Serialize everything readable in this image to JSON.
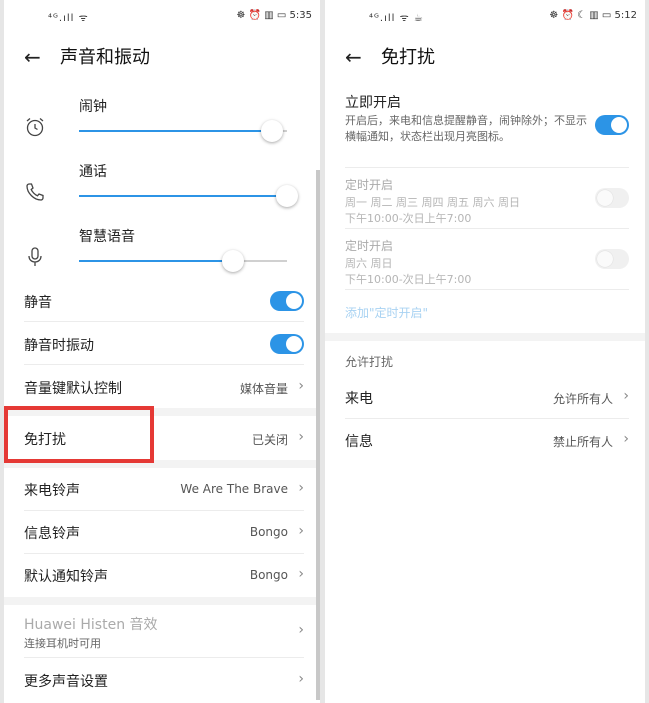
{
  "left": {
    "status": {
      "signal": "⁴ᴳ.ıll ᯤ",
      "right": "☸ ⏰ ▥ ▭ 5:35"
    },
    "title": "声音和振动",
    "volumes": [
      {
        "label": "闹钟",
        "icon": "alarm-clock-icon",
        "level": 0.93
      },
      {
        "label": "通话",
        "icon": "phone-icon",
        "level": 1.0
      },
      {
        "label": "智慧语音",
        "icon": "microphone-icon",
        "level": 0.74
      }
    ],
    "mute_label": "静音",
    "mute_on": true,
    "mute_vibrate_label": "静音时振动",
    "mute_vibrate_on": true,
    "volume_key_label": "音量键默认控制",
    "volume_key_value": "媒体音量",
    "dnd_label": "免打扰",
    "dnd_value": "已关闭",
    "ringtone_label": "来电铃声",
    "ringtone_value": "We Are The Brave",
    "message_tone_label": "信息铃声",
    "message_tone_value": "Bongo",
    "notification_tone_label": "默认通知铃声",
    "notification_tone_value": "Bongo",
    "histen_label": "Huawei Histen 音效",
    "histen_sub": "连接耳机时可用",
    "more_label": "更多声音设置"
  },
  "right": {
    "status": {
      "signal": "⁴ᴳ.ıll ᯤ ☕",
      "right": "☸ ⏰ ☾ ▥ ▭ 5:12"
    },
    "title": "免打扰",
    "immediate_label": "立即开启",
    "immediate_desc": "开启后，来电和信息提醒静音，闹钟除外；不显示横幅通知，状态栏出现月亮图标。",
    "immediate_on": true,
    "schedules": [
      {
        "label": "定时开启",
        "days": "周一 周二 周三 周四 周五 周六 周日",
        "time": "下午10:00-次日上午7:00",
        "on": false
      },
      {
        "label": "定时开启",
        "days": "周六 周日",
        "time": "下午10:00-次日上午7:00",
        "on": false
      }
    ],
    "add_schedule": "添加\"定时开启\"",
    "allow_caption": "允许打扰",
    "calls_label": "来电",
    "calls_value": "允许所有人",
    "messages_label": "信息",
    "messages_value": "禁止所有人"
  },
  "colors": {
    "accent": "#2c94e6",
    "highlight": "#e53935",
    "separator": "#ececec"
  }
}
